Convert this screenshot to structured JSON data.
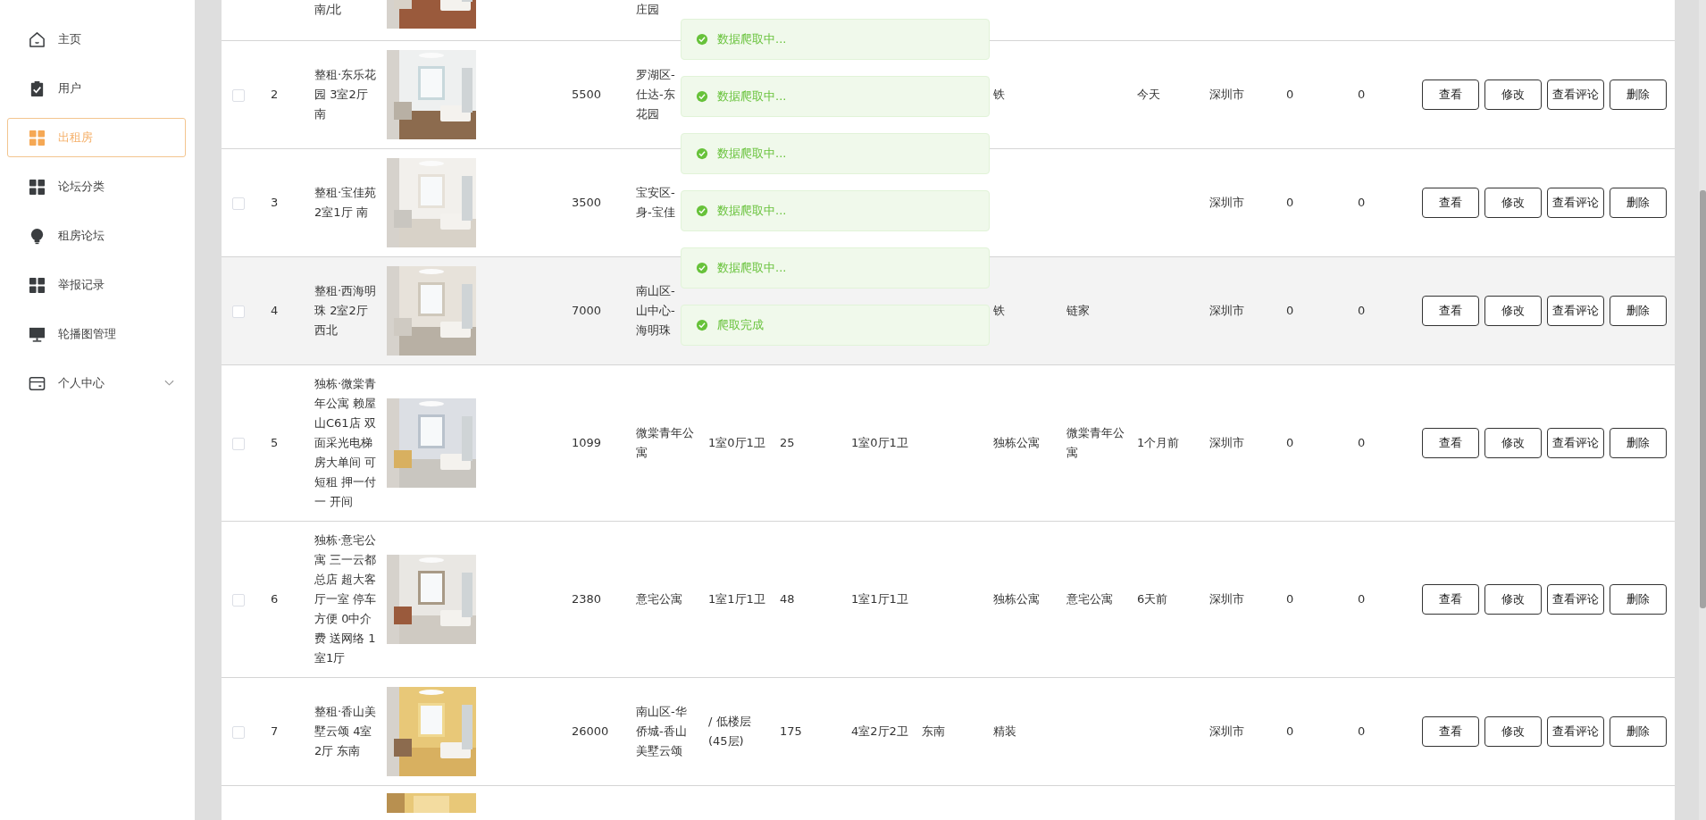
{
  "sidebar": {
    "items": [
      {
        "label": "主页",
        "selected": false
      },
      {
        "label": "用户",
        "selected": false
      },
      {
        "label": "出租房",
        "selected": true
      },
      {
        "label": "论坛分类",
        "selected": false
      },
      {
        "label": "租房论坛",
        "selected": false
      },
      {
        "label": "举报记录",
        "selected": false
      },
      {
        "label": "轮播图管理",
        "selected": false
      },
      {
        "label": "个人中心",
        "selected": false,
        "expanded": false
      }
    ]
  },
  "table": {
    "rows": [
      {
        "cut_off": true,
        "column_3": "南/北",
        "column_6": "庄园"
      },
      {
        "checked": false,
        "highlighted": false,
        "column_2": "2",
        "column_3": "整租·东乐花园 3室2厅南",
        "column_5": "5500",
        "column_6": [
          "罗湖区-",
          "仕达-东",
          "花园"
        ],
        "column_11": "铁",
        "column_13": "今天",
        "column_14": "深圳市",
        "column_15": "0",
        "column_16": "0",
        "actions": [
          "查看",
          "修改",
          "查看评论",
          "删除"
        ]
      },
      {
        "checked": false,
        "highlighted": false,
        "column_2": "3",
        "column_3": "整租·宝佳苑 2室1厅 南",
        "column_5": "3500",
        "column_6": [
          "宝安区-",
          "身-宝佳"
        ],
        "column_14": "深圳市",
        "column_15": "0",
        "column_16": "0",
        "actions": [
          "查看",
          "修改",
          "查看评论",
          "删除"
        ]
      },
      {
        "checked": false,
        "highlighted": true,
        "column_2": "4",
        "column_3": "整租·西海明珠 2室2厅西北",
        "column_5": "7000",
        "column_6": [
          "南山区-",
          "山中心-",
          "海明珠"
        ],
        "column_11": "铁",
        "column_12": "链家",
        "column_14": "深圳市",
        "column_15": "0",
        "column_16": "0",
        "actions": [
          "查看",
          "修改",
          "查看评论",
          "删除"
        ]
      },
      {
        "checked": false,
        "highlighted": false,
        "column_2": "5",
        "column_3": "独栋·微棠青年公寓 赖屋山C61店 双面采光电梯房大单间 可短租 押一付一 开间",
        "column_5": "1099",
        "column_6": "微棠青年公寓",
        "column_7": "1室0厅1卫",
        "column_8": "25",
        "column_9": "1室0厅1卫",
        "column_11": "独栋公寓",
        "column_12": "微棠青年公寓",
        "column_13": "1个月前",
        "column_14": "深圳市",
        "column_15": "0",
        "column_16": "0",
        "actions": [
          "查看",
          "修改",
          "查看评论",
          "删除"
        ]
      },
      {
        "checked": false,
        "highlighted": false,
        "column_2": "6",
        "column_3": "独栋·意宅公寓 三一云都总店 超大客厅一室 停车方便 0中介费 送网络 1室1厅",
        "column_5": "2380",
        "column_6": "意宅公寓",
        "column_7": "1室1厅1卫",
        "column_8": "48",
        "column_9": "1室1厅1卫",
        "column_11": "独栋公寓",
        "column_12": "意宅公寓",
        "column_13": "6天前",
        "column_14": "深圳市",
        "column_15": "0",
        "column_16": "0",
        "actions": [
          "查看",
          "修改",
          "查看评论",
          "删除"
        ]
      },
      {
        "checked": false,
        "highlighted": false,
        "column_2": "7",
        "column_3": "整租·香山美墅云颂 4室2厅 东南",
        "column_5": "26000",
        "column_6": "南山区-华侨城-香山美墅云颂",
        "column_7": "/ 低楼层 (45层)",
        "column_8": "175",
        "column_9": "4室2厅2卫",
        "column_10": "东南",
        "column_11": "精装",
        "column_14": "深圳市",
        "column_15": "0",
        "column_16": "0",
        "actions": [
          "查看",
          "修改",
          "查看评论",
          "删除"
        ]
      }
    ]
  },
  "toasts": [
    {
      "message": "数据爬取中...",
      "kind": "success"
    },
    {
      "message": "数据爬取中...",
      "kind": "success"
    },
    {
      "message": "数据爬取中...",
      "kind": "success"
    },
    {
      "message": "数据爬取中...",
      "kind": "success"
    },
    {
      "message": "数据爬取中...",
      "kind": "success"
    },
    {
      "message": "爬取完成",
      "kind": "success"
    }
  ]
}
